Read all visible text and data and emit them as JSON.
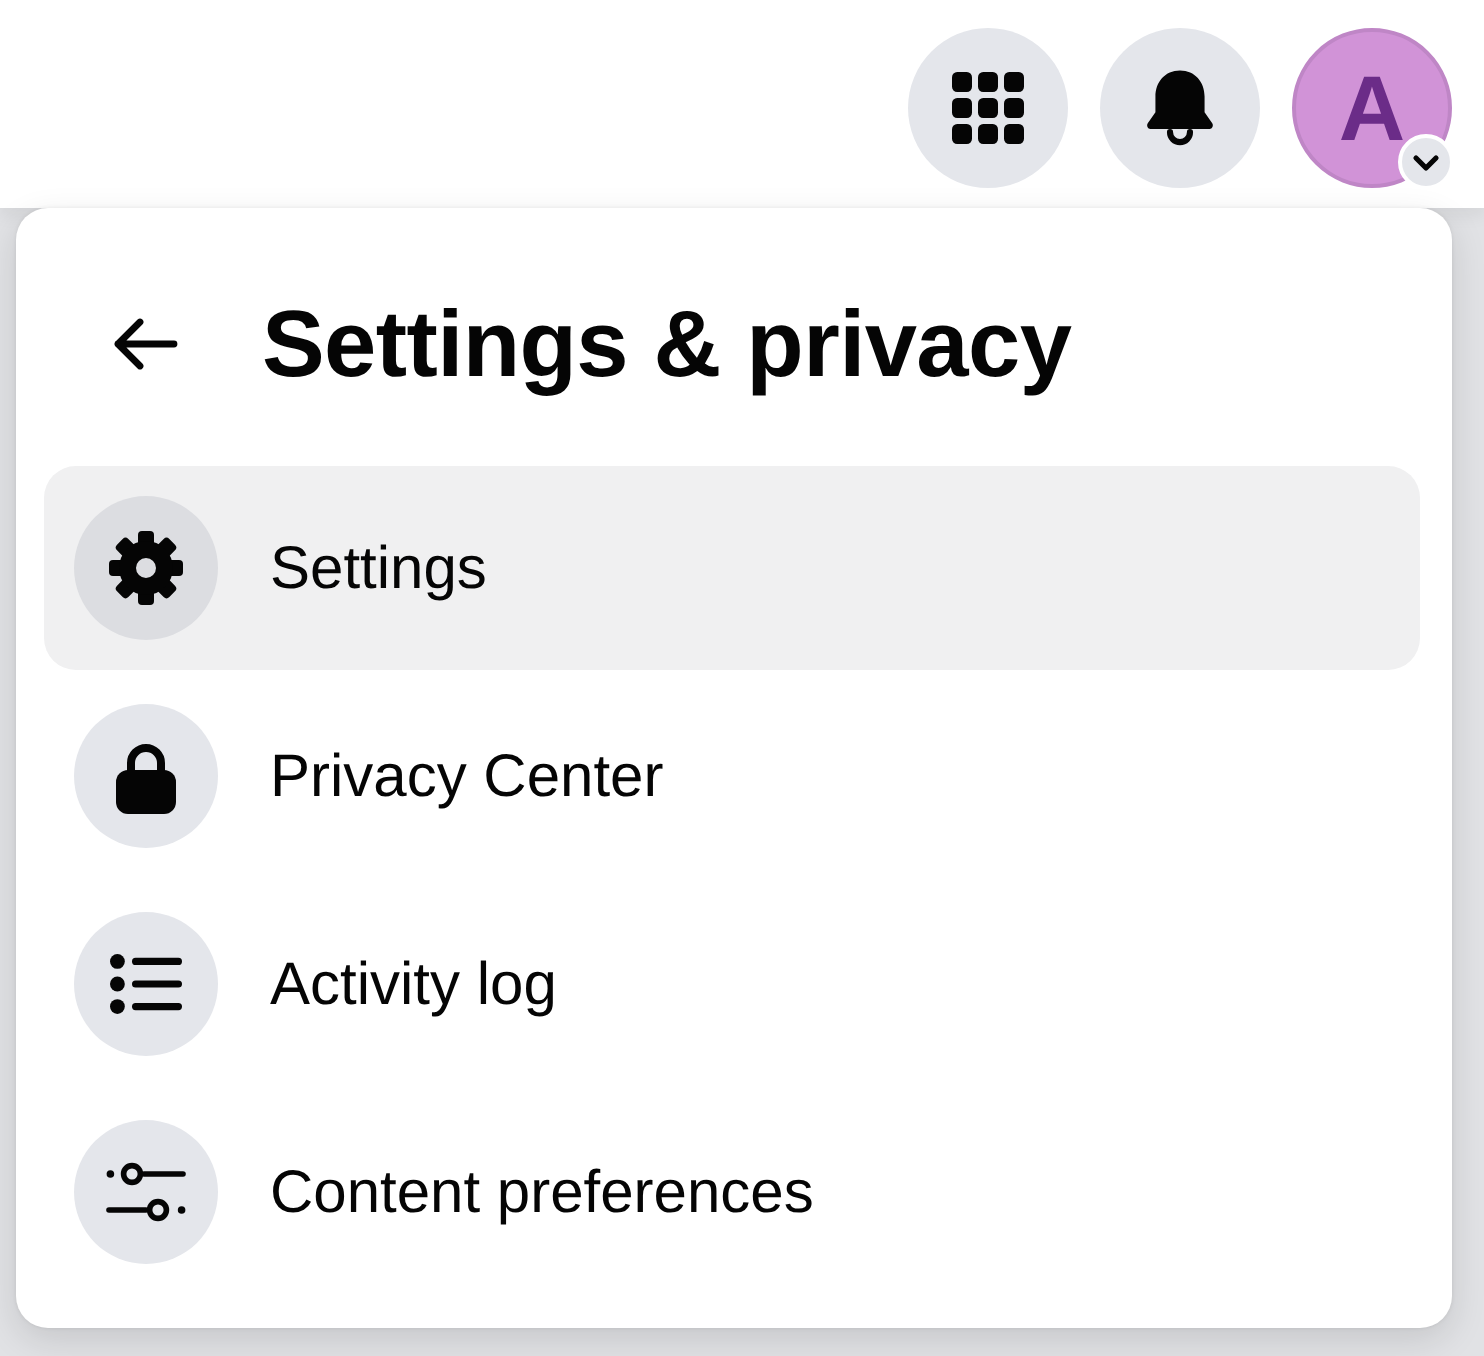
{
  "top_bar": {
    "avatar_letter": "A"
  },
  "menu": {
    "title": "Settings & privacy",
    "items": [
      {
        "label": "Settings",
        "selected": true
      },
      {
        "label": "Privacy Center",
        "selected": false
      },
      {
        "label": "Activity log",
        "selected": false
      },
      {
        "label": "Content preferences",
        "selected": false
      }
    ]
  }
}
